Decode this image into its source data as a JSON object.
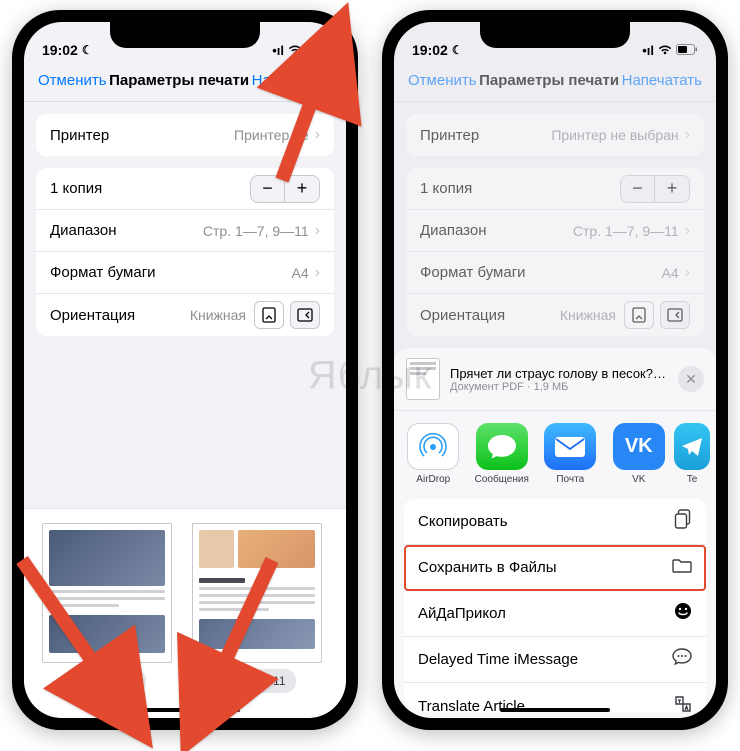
{
  "watermark": "Яблык",
  "status": {
    "time": "19:02",
    "signal": "●●●●",
    "wifi": "📶",
    "battery": "▮▯"
  },
  "nav": {
    "cancel": "Отменить",
    "title": "Параметры печати",
    "print": "Напечатать"
  },
  "printer": {
    "label": "Принтер",
    "value_full": "Принтер не выбран",
    "value_cut": "Принтер не"
  },
  "copies": {
    "label": "1 копия"
  },
  "range": {
    "label": "Диапазон",
    "value": "Стр. 1—7, 9—11"
  },
  "paper": {
    "label": "Формат бумаги",
    "value": "A4"
  },
  "orientation": {
    "label": "Ориентация",
    "value": "Книжная"
  },
  "thumbs": {
    "p5": "5 из 11",
    "p6": "6 из 11"
  },
  "sheet": {
    "doc_title": "Прячет ли страус голову в песок? | Яб…",
    "doc_sub": "Документ PDF · 1,9 МБ",
    "apps": {
      "airdrop": "AirDrop",
      "messages": "Сообщения",
      "mail": "Почта",
      "vk": "VK",
      "tg": "Te"
    },
    "actions": {
      "copy": "Скопировать",
      "save_files": "Сохранить в Файлы",
      "prikol": "АйДаПрикол",
      "delayed": "Delayed Time iMessage",
      "translate": "Translate Article"
    }
  }
}
